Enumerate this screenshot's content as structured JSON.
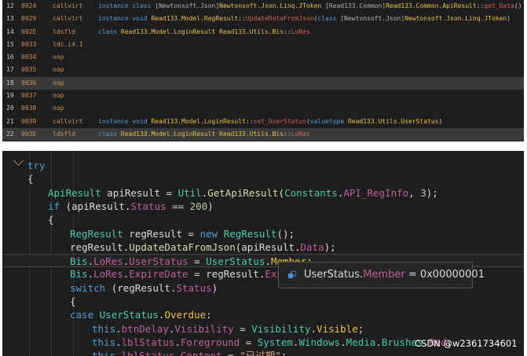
{
  "il_rows": [
    {
      "idx": "12",
      "off": "0024",
      "op": "callvirt",
      "arg": [
        [
          "kw",
          "instance "
        ],
        [
          "kw",
          "class "
        ],
        [
          "ns",
          "[Newtonsoft.Json]"
        ],
        [
          "ty",
          "Newtonsoft.Json.Linq.JToken "
        ],
        [
          "ns",
          "[Read133.Common]"
        ],
        [
          "ty",
          "Read133.Common.ApiResult"
        ],
        [
          "pl",
          "::"
        ],
        [
          "me",
          "get_Data"
        ],
        [
          "pl",
          "()"
        ]
      ]
    },
    {
      "idx": "13",
      "off": "0029",
      "op": "callvirt",
      "arg": [
        [
          "kw",
          "instance "
        ],
        [
          "kw",
          "void "
        ],
        [
          "ty",
          "Read133.Model.RegResult"
        ],
        [
          "pl",
          "::"
        ],
        [
          "me",
          "UpdateDataFromJson"
        ],
        [
          "pl",
          "("
        ],
        [
          "kw",
          "class "
        ],
        [
          "ns",
          "[Newtonsoft.Json]"
        ],
        [
          "ty",
          "Newtonsoft.Json.Linq.JToken"
        ],
        [
          "pl",
          ")"
        ]
      ]
    },
    {
      "idx": "14",
      "off": "002E",
      "op": "ldsfld",
      "arg": [
        [
          "kw",
          "class "
        ],
        [
          "ty",
          "Read133.Model.LoginResult "
        ],
        [
          "ty",
          "Read133.Utils.Bis"
        ],
        [
          "pl",
          "::"
        ],
        [
          "me",
          "LoRes"
        ]
      ]
    },
    {
      "idx": "15",
      "off": "0033",
      "op": "ldc.i4.1",
      "arg": []
    },
    {
      "idx": "16",
      "off": "0034",
      "op": "nop",
      "arg": []
    },
    {
      "idx": "17",
      "off": "0035",
      "op": "nop",
      "arg": []
    },
    {
      "idx": "18",
      "off": "0036",
      "op": "nop",
      "arg": []
    },
    {
      "idx": "19",
      "off": "0037",
      "op": "nop",
      "arg": []
    },
    {
      "idx": "20",
      "off": "0038",
      "op": "nop",
      "arg": []
    },
    {
      "idx": "21",
      "off": "0039",
      "op": "callvirt",
      "arg": [
        [
          "kw",
          "instance "
        ],
        [
          "kw",
          "void "
        ],
        [
          "ty",
          "Read133.Model.LoginResult"
        ],
        [
          "pl",
          "::"
        ],
        [
          "me",
          "set_UserStatus"
        ],
        [
          "pl",
          "("
        ],
        [
          "kw",
          "valuetype "
        ],
        [
          "ty",
          "Read133.Utils.UserStatus"
        ],
        [
          "pl",
          ")"
        ]
      ]
    },
    {
      "idx": "22",
      "off": "003E",
      "op": "ldsfld",
      "arg": [
        [
          "kw",
          "class "
        ],
        [
          "ty",
          "Read133.Model.LoginResult "
        ],
        [
          "ty",
          "Read133.Utils.Bis"
        ],
        [
          "pl",
          "::"
        ],
        [
          "me",
          "LoRes"
        ]
      ]
    }
  ],
  "il_highlight_rows": [
    6,
    10
  ],
  "code_lines": [
    [
      [
        "kw",
        "try"
      ]
    ],
    [
      [
        "pn",
        "{"
      ]
    ],
    [
      [
        "ty",
        "ApiResult "
      ],
      [
        "var",
        "apiResult "
      ],
      [
        "pn",
        "= "
      ],
      [
        "ty",
        "Util"
      ],
      [
        "pn",
        "."
      ],
      [
        "fn",
        "GetApiResult"
      ],
      [
        "pn",
        "("
      ],
      [
        "ty",
        "Constants"
      ],
      [
        "pn",
        "."
      ],
      [
        "mem",
        "API_RegInfo"
      ],
      [
        "pn",
        ", "
      ],
      [
        "num",
        "3"
      ],
      [
        "pn",
        ");"
      ]
    ],
    [
      [
        "kw",
        "if "
      ],
      [
        "pn",
        "("
      ],
      [
        "var",
        "apiResult"
      ],
      [
        "pn",
        "."
      ],
      [
        "mem",
        "Status "
      ],
      [
        "pn",
        "== "
      ],
      [
        "num",
        "200"
      ],
      [
        "pn",
        ")"
      ]
    ],
    [
      [
        "pn",
        "{"
      ]
    ],
    [
      [
        "ty",
        "RegResult "
      ],
      [
        "var",
        "regResult "
      ],
      [
        "pn",
        "= "
      ],
      [
        "kw",
        "new "
      ],
      [
        "ty",
        "RegResult"
      ],
      [
        "pn",
        "();"
      ]
    ],
    [
      [
        "var",
        "regResult"
      ],
      [
        "pn",
        "."
      ],
      [
        "fn",
        "UpdateDataFromJson"
      ],
      [
        "pn",
        "("
      ],
      [
        "var",
        "apiResult"
      ],
      [
        "pn",
        "."
      ],
      [
        "mem",
        "Data"
      ],
      [
        "pn",
        ");"
      ]
    ],
    [
      [
        "ty",
        "Bis"
      ],
      [
        "pn",
        "."
      ],
      [
        "mem",
        "LoRes"
      ],
      [
        "pn",
        "."
      ],
      [
        "mem",
        "UserStatus "
      ],
      [
        "pn",
        "= "
      ],
      [
        "ty",
        "UserStatus"
      ],
      [
        "pn",
        "."
      ],
      [
        "en",
        "Member"
      ],
      [
        "pn",
        ";"
      ]
    ],
    [
      [
        "ty",
        "Bis"
      ],
      [
        "pn",
        "."
      ],
      [
        "mem",
        "LoRes"
      ],
      [
        "pn",
        "."
      ],
      [
        "mem",
        "ExpireDate "
      ],
      [
        "pn",
        "= "
      ],
      [
        "var",
        "regResult"
      ],
      [
        "pn",
        "."
      ],
      [
        "mem",
        "Expire"
      ]
    ],
    [
      [
        "kw",
        "switch "
      ],
      [
        "pn",
        "("
      ],
      [
        "var",
        "regResult"
      ],
      [
        "pn",
        "."
      ],
      [
        "mem",
        "Status"
      ],
      [
        "pn",
        ")"
      ]
    ],
    [
      [
        "pn",
        "{"
      ]
    ],
    [
      [
        "kw",
        "case "
      ],
      [
        "ty",
        "UserStatus"
      ],
      [
        "pn",
        "."
      ],
      [
        "en",
        "Overdue"
      ],
      [
        "pn",
        ":"
      ]
    ],
    [
      [
        "kw",
        "this"
      ],
      [
        "pn",
        "."
      ],
      [
        "mem",
        "btnDelay"
      ],
      [
        "pn",
        "."
      ],
      [
        "mem",
        "Visibility "
      ],
      [
        "pn",
        "= "
      ],
      [
        "ty",
        "Visibility"
      ],
      [
        "pn",
        "."
      ],
      [
        "en",
        "Visible"
      ],
      [
        "pn",
        ";"
      ]
    ],
    [
      [
        "kw",
        "this"
      ],
      [
        "pn",
        "."
      ],
      [
        "mem",
        "lblStatus"
      ],
      [
        "pn",
        "."
      ],
      [
        "mem",
        "Foreground "
      ],
      [
        "pn",
        "= "
      ],
      [
        "ty",
        "System"
      ],
      [
        "pn",
        "."
      ],
      [
        "ty",
        "Windows"
      ],
      [
        "pn",
        "."
      ],
      [
        "ty",
        "Media"
      ],
      [
        "pn",
        "."
      ],
      [
        "ty",
        "Brushes"
      ],
      [
        "pn",
        "."
      ],
      [
        "mem",
        "Red"
      ],
      [
        "pn",
        ";"
      ]
    ],
    [
      [
        "kw",
        "this"
      ],
      [
        "pn",
        "."
      ],
      [
        "mem",
        "lblStatus"
      ],
      [
        "pn",
        "."
      ],
      [
        "mem",
        "Content "
      ],
      [
        "pn",
        "= "
      ],
      [
        "str",
        "\"已过期\""
      ],
      [
        "pn",
        ";"
      ]
    ]
  ],
  "current_line": 7,
  "datatip": {
    "prefix": "UserStatus.",
    "member": "Member",
    "suffix": " = 0x00000001"
  },
  "watermark": "CSDN @w2361734601",
  "colors": {
    "editor_bg": "#1e1e1e",
    "keyword": "#569cd6",
    "type": "#4ec9b0",
    "member": "#c0609a",
    "opcode": "#c8935a"
  }
}
